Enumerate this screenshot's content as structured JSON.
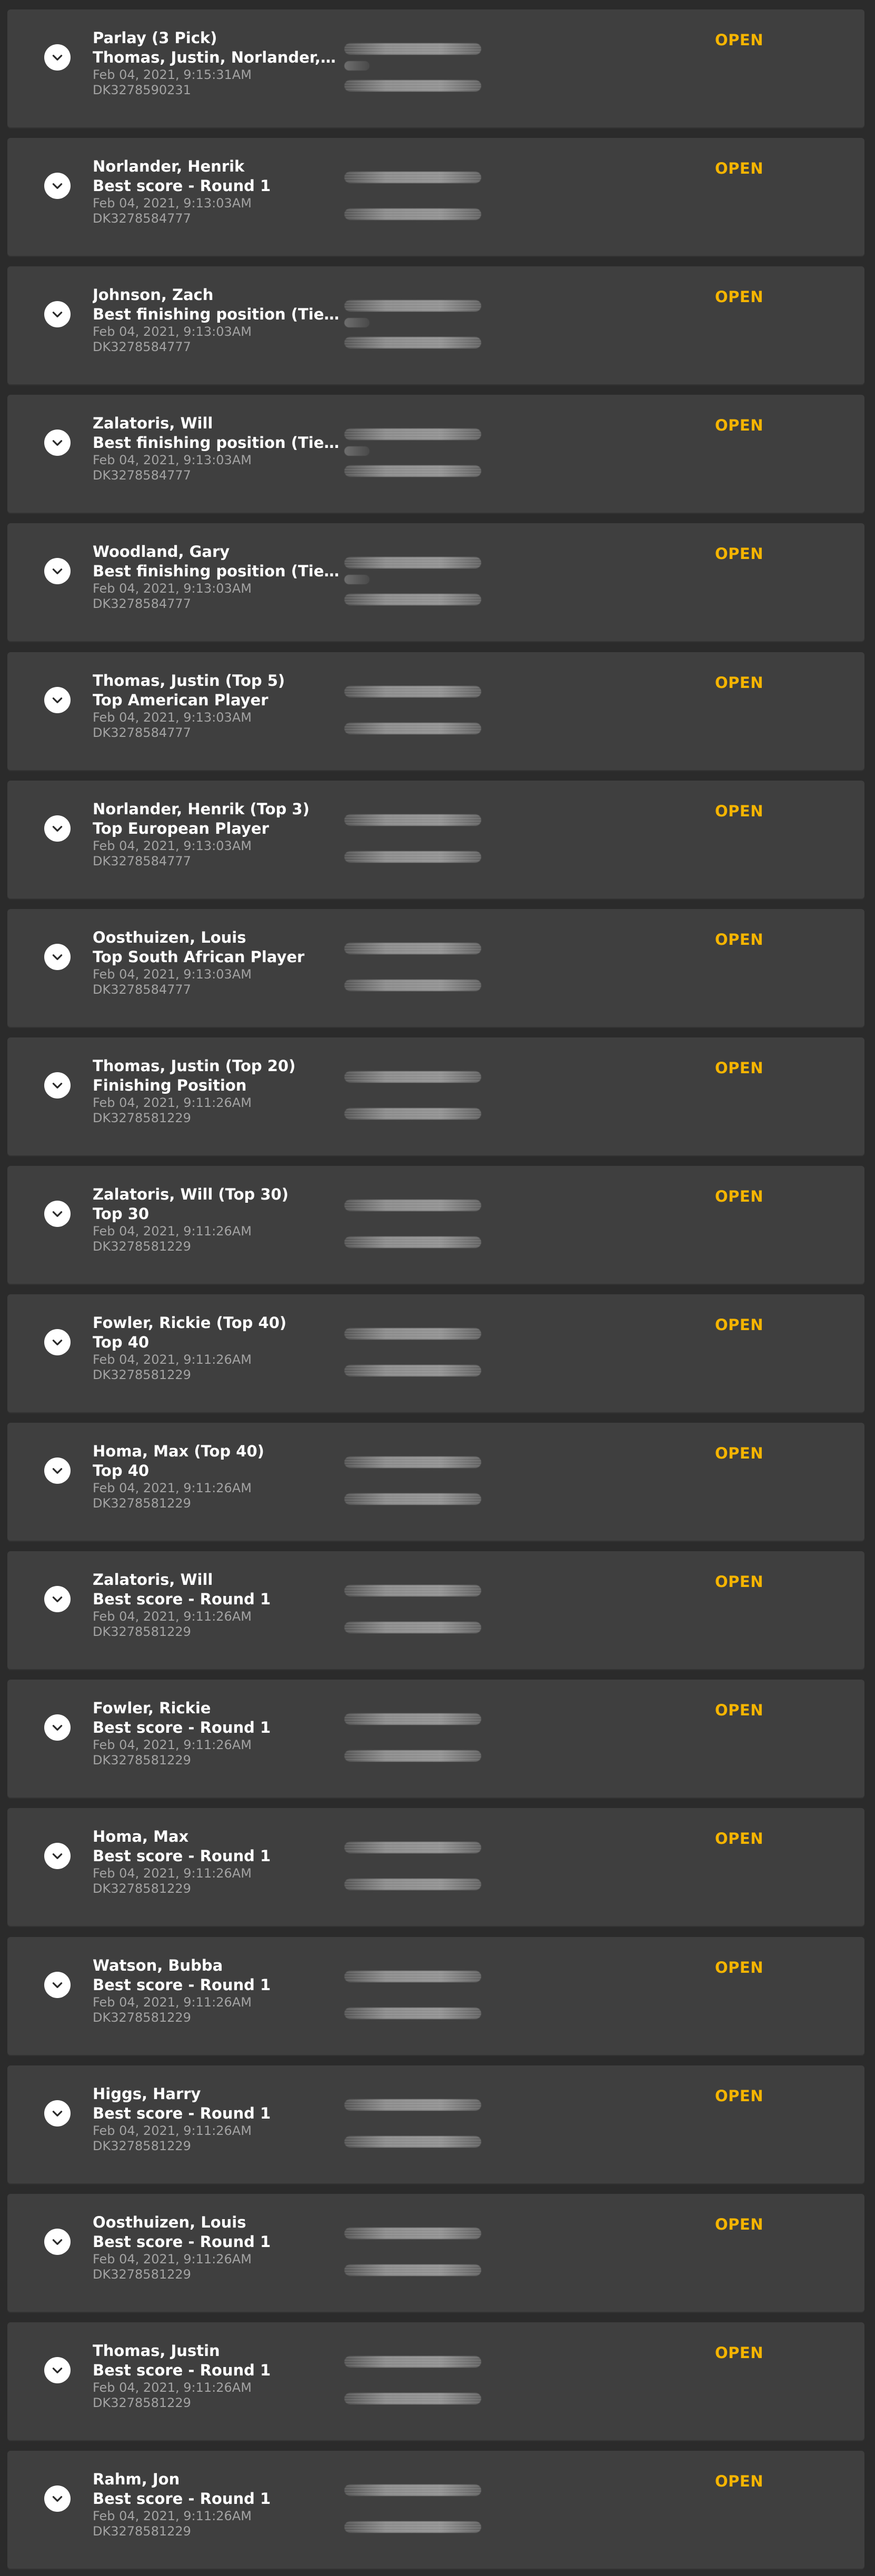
{
  "colors": {
    "page_background": "#2b2b2b",
    "card_background": "#3f3f3f",
    "status_open": "#f5b400",
    "secondary_text": "#a3a3a3"
  },
  "icons": {
    "expand": "chevron-down-icon",
    "odds_obscured": "blurred-odds"
  },
  "bets": [
    {
      "name": "Parlay (3 Pick)",
      "market": "Thomas, Justin, Norlander, He...",
      "date": "Feb 04, 2021, 9:15:31AM",
      "ticket": "DK3278590231",
      "status": "OPEN"
    },
    {
      "name": "Norlander, Henrik",
      "market": "Best score - Round 1",
      "date": "Feb 04, 2021, 9:13:03AM",
      "ticket": "DK3278584777",
      "status": "OPEN"
    },
    {
      "name": "Johnson, Zach",
      "market": "Best finishing position (Tie no ...",
      "date": "Feb 04, 2021, 9:13:03AM",
      "ticket": "DK3278584777",
      "status": "OPEN"
    },
    {
      "name": "Zalatoris, Will",
      "market": "Best finishing position (Tie no ...",
      "date": "Feb 04, 2021, 9:13:03AM",
      "ticket": "DK3278584777",
      "status": "OPEN"
    },
    {
      "name": "Woodland, Gary",
      "market": "Best finishing position (Tie no ...",
      "date": "Feb 04, 2021, 9:13:03AM",
      "ticket": "DK3278584777",
      "status": "OPEN"
    },
    {
      "name": "Thomas, Justin (Top 5)",
      "market": "Top American Player",
      "date": "Feb 04, 2021, 9:13:03AM",
      "ticket": "DK3278584777",
      "status": "OPEN"
    },
    {
      "name": "Norlander, Henrik (Top 3)",
      "market": "Top European Player",
      "date": "Feb 04, 2021, 9:13:03AM",
      "ticket": "DK3278584777",
      "status": "OPEN"
    },
    {
      "name": "Oosthuizen, Louis",
      "market": "Top South African Player",
      "date": "Feb 04, 2021, 9:13:03AM",
      "ticket": "DK3278584777",
      "status": "OPEN"
    },
    {
      "name": "Thomas, Justin (Top 20)",
      "market": "Finishing Position",
      "date": "Feb 04, 2021, 9:11:26AM",
      "ticket": "DK3278581229",
      "status": "OPEN"
    },
    {
      "name": "Zalatoris, Will (Top 30)",
      "market": "Top 30",
      "date": "Feb 04, 2021, 9:11:26AM",
      "ticket": "DK3278581229",
      "status": "OPEN"
    },
    {
      "name": "Fowler, Rickie (Top 40)",
      "market": "Top 40",
      "date": "Feb 04, 2021, 9:11:26AM",
      "ticket": "DK3278581229",
      "status": "OPEN"
    },
    {
      "name": "Homa, Max (Top 40)",
      "market": "Top 40",
      "date": "Feb 04, 2021, 9:11:26AM",
      "ticket": "DK3278581229",
      "status": "OPEN"
    },
    {
      "name": "Zalatoris, Will",
      "market": "Best score - Round 1",
      "date": "Feb 04, 2021, 9:11:26AM",
      "ticket": "DK3278581229",
      "status": "OPEN"
    },
    {
      "name": "Fowler, Rickie",
      "market": "Best score - Round 1",
      "date": "Feb 04, 2021, 9:11:26AM",
      "ticket": "DK3278581229",
      "status": "OPEN"
    },
    {
      "name": "Homa, Max",
      "market": "Best score - Round 1",
      "date": "Feb 04, 2021, 9:11:26AM",
      "ticket": "DK3278581229",
      "status": "OPEN"
    },
    {
      "name": "Watson, Bubba",
      "market": "Best score - Round 1",
      "date": "Feb 04, 2021, 9:11:26AM",
      "ticket": "DK3278581229",
      "status": "OPEN"
    },
    {
      "name": "Higgs, Harry",
      "market": "Best score - Round 1",
      "date": "Feb 04, 2021, 9:11:26AM",
      "ticket": "DK3278581229",
      "status": "OPEN"
    },
    {
      "name": "Oosthuizen, Louis",
      "market": "Best score - Round 1",
      "date": "Feb 04, 2021, 9:11:26AM",
      "ticket": "DK3278581229",
      "status": "OPEN"
    },
    {
      "name": "Thomas, Justin",
      "market": "Best score - Round 1",
      "date": "Feb 04, 2021, 9:11:26AM",
      "ticket": "DK3278581229",
      "status": "OPEN"
    },
    {
      "name": "Rahm, Jon",
      "market": "Best score - Round 1",
      "date": "Feb 04, 2021, 9:11:26AM",
      "ticket": "DK3278581229",
      "status": "OPEN"
    }
  ]
}
